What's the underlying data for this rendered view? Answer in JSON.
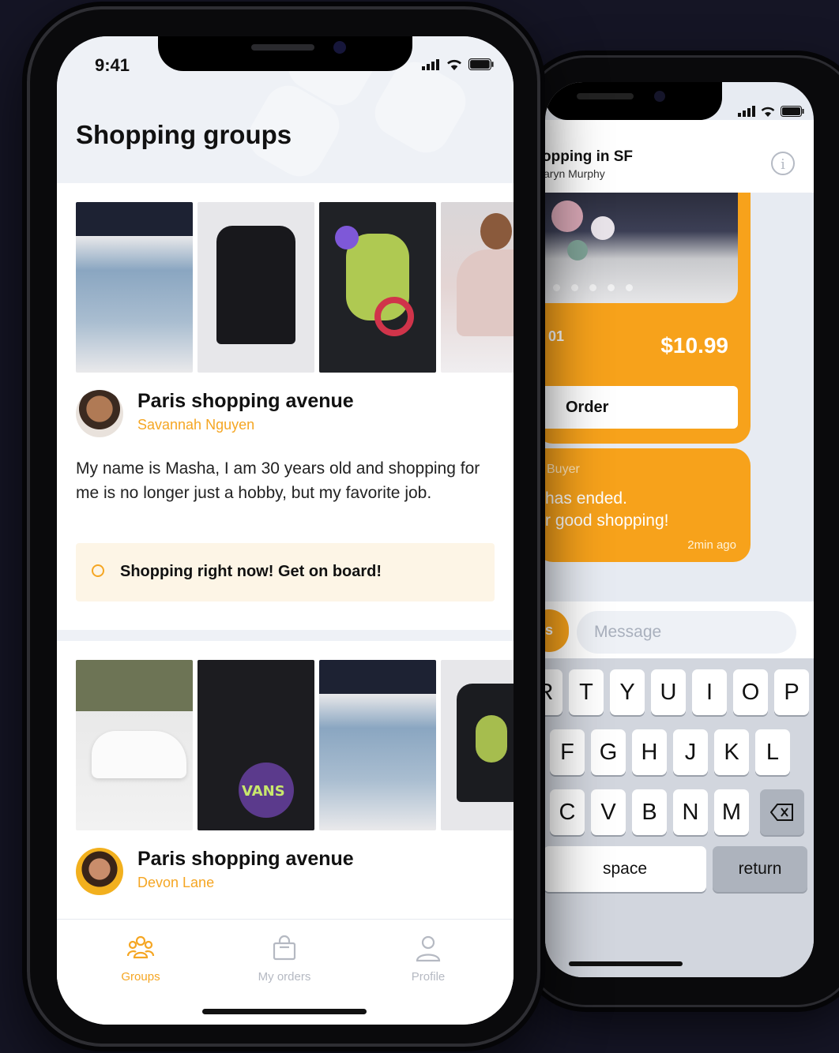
{
  "front_screen": {
    "status_time": "9:41",
    "title": "Shopping groups",
    "groups": [
      {
        "title": "Paris shopping avenue",
        "owner": "Savannah Nguyen",
        "description": "My name is Masha, I am 30 years old and shopping for me is no longer just a hobby, but my favorite job.",
        "live_banner": "Shopping right now! Get on board!"
      },
      {
        "title": "Paris shopping avenue",
        "owner": "Devon Lane"
      }
    ],
    "tabs": [
      {
        "label": "Groups",
        "icon": "groups-icon",
        "active": true
      },
      {
        "label": "My orders",
        "icon": "shopping-bag-icon",
        "active": false
      },
      {
        "label": "Profile",
        "icon": "person-icon",
        "active": false
      }
    ],
    "colors": {
      "accent": "#f5a623",
      "banner_bg": "#fdf5e6"
    }
  },
  "back_screen": {
    "chat_title": "opping in SF",
    "chat_subtitle": "aryn Murphy",
    "order_card": {
      "quantity": "01",
      "price": "$10.99",
      "order_button": "Order"
    },
    "message": {
      "role": "Buyer",
      "line1": "has ended.",
      "line2": "r good shopping!",
      "time": "2min ago"
    },
    "send_button": "s",
    "message_placeholder": "Message",
    "keyboard": {
      "row1": [
        "R",
        "T",
        "Y",
        "U",
        "I",
        "O",
        "P"
      ],
      "row2": [
        "F",
        "G",
        "H",
        "J",
        "K",
        "L"
      ],
      "row3": [
        "C",
        "V",
        "B",
        "N",
        "M"
      ],
      "space": "space",
      "return": "return"
    },
    "colors": {
      "accent": "#f7a21b"
    }
  }
}
